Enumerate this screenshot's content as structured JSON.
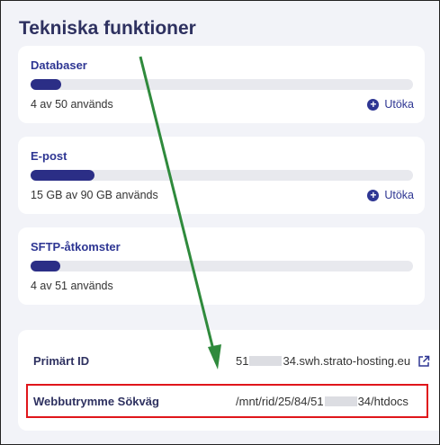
{
  "title": "Tekniska funktioner",
  "features": [
    {
      "label": "Databaser",
      "usage": "4 av 50 används",
      "fraction": 0.08,
      "action": "Utöka"
    },
    {
      "label": "E-post",
      "usage": "15 GB av 90 GB används",
      "fraction": 0.167,
      "action": "Utöka"
    },
    {
      "label": "SFTP-åtkomster",
      "usage": "4 av 51 används",
      "fraction": 0.078
    }
  ],
  "primary_id": {
    "label": "Primärt ID",
    "value_prefix": "51",
    "value_suffix": "34.swh.strato-hosting.eu"
  },
  "webshop_path": {
    "label": "Webbutrymme Sökväg",
    "value_prefix": "/mnt/rid/25/84/51",
    "value_suffix": "34/htdocs"
  },
  "icons": {
    "expand": "plus-circle-icon",
    "external": "external-link-icon"
  },
  "colors": {
    "accent": "#2e3693",
    "bar_fill": "#2b2e86",
    "annotation_arrow": "#2f8a3c",
    "annotation_box": "#e0161b"
  }
}
